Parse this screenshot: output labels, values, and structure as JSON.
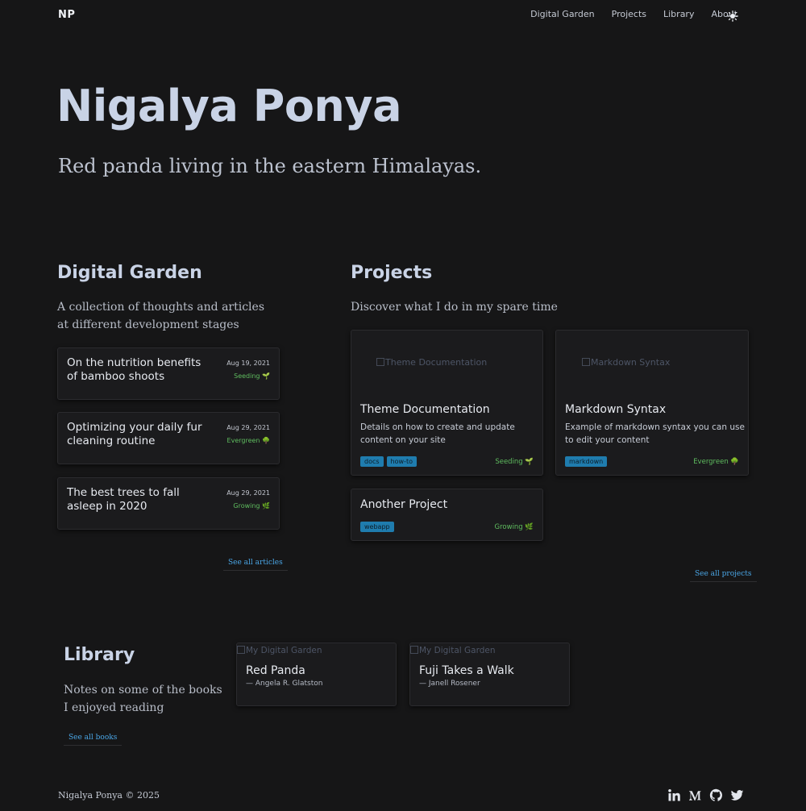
{
  "header": {
    "logo": "NP",
    "nav": [
      "Digital Garden",
      "Projects",
      "Library",
      "About"
    ]
  },
  "hero": {
    "title": "Nigalya Ponya",
    "subtitle": "Red panda living in the eastern Himalayas."
  },
  "garden": {
    "title": "Digital Garden",
    "description": "A collection of thoughts and articles at different development stages",
    "articles": [
      {
        "title": "On the nutrition benefits of bamboo shoots",
        "date": "Aug 19, 2021",
        "stage": "Seeding 🌱"
      },
      {
        "title": "Optimizing your daily fur cleaning routine",
        "date": "Aug 29, 2021",
        "stage": "Evergreen 🌳"
      },
      {
        "title": "The best trees to fall asleep in 2020",
        "date": "Aug 29, 2021",
        "stage": "Growing 🌿"
      }
    ],
    "see_all": "See all articles"
  },
  "projects": {
    "title": "Projects",
    "description": "Discover what I do in my spare time",
    "items": [
      {
        "image_alt": "Theme Documentation",
        "title": "Theme Documentation",
        "description": "Details on how to create and update content on your site",
        "tags": [
          "docs",
          "how-to"
        ],
        "stage": "Seeding 🌱"
      },
      {
        "image_alt": "Markdown Syntax",
        "title": "Markdown Syntax",
        "description": "Example of markdown syntax you can use to edit your content",
        "tags": [
          "markdown"
        ],
        "stage": "Evergreen 🌳"
      },
      {
        "title": "Another Project",
        "tags": [
          "webapp"
        ],
        "stage": "Growing 🌿"
      }
    ],
    "see_all": "See all projects"
  },
  "library": {
    "title": "Library",
    "description": "Notes on some of the books I enjoyed reading",
    "books": [
      {
        "image_alt": "My Digital Garden",
        "title": "Red Panda",
        "author": "— Angela R. Glatston"
      },
      {
        "image_alt": "My Digital Garden",
        "title": "Fuji Takes a Walk",
        "author": "— Janell Rosener"
      }
    ],
    "see_all": "See all books"
  },
  "footer": {
    "copyright": "Nigalya Ponya © 2025",
    "socials": [
      "linkedin-icon",
      "medium-icon",
      "github-icon",
      "twitter-icon"
    ]
  },
  "colors": {
    "background": "#161617",
    "heading": "#c9d3e6",
    "link": "#4aa6e6",
    "tag": "#1f7cae",
    "stage": "#5fbd5f"
  }
}
